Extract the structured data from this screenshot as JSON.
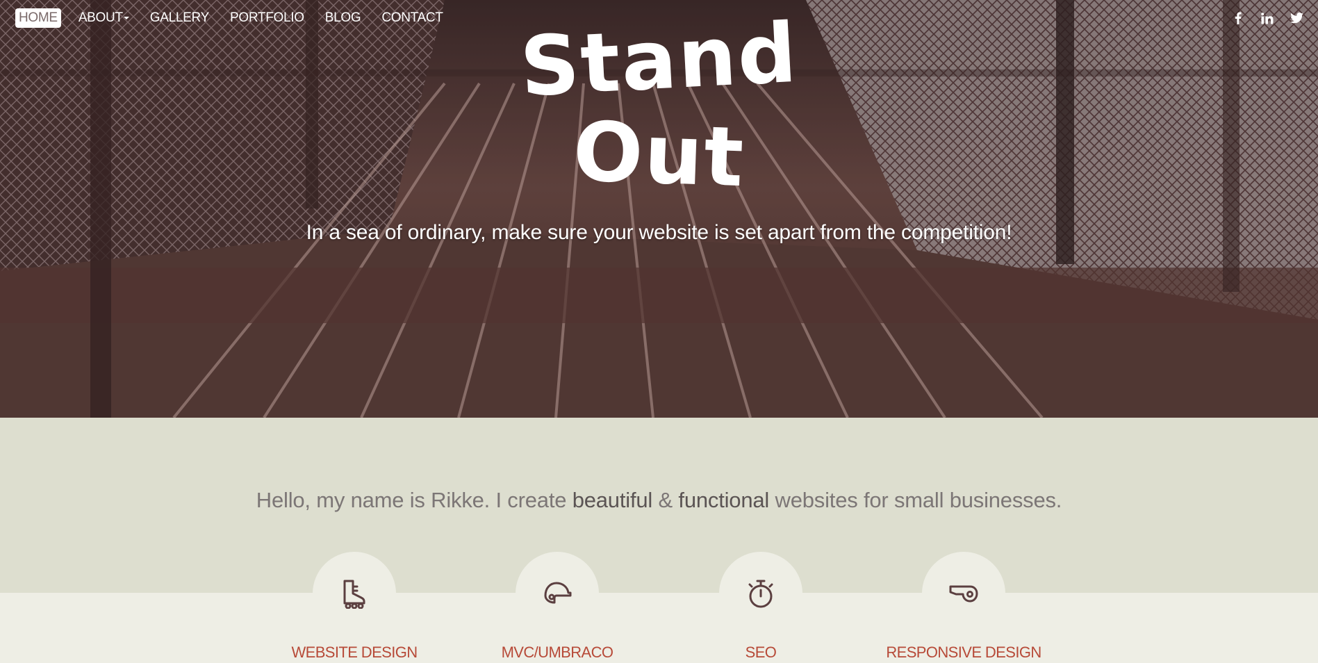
{
  "nav": {
    "items": [
      {
        "label": "HOME",
        "active": true
      },
      {
        "label": "ABOUT",
        "dropdown": true
      },
      {
        "label": "GALLERY"
      },
      {
        "label": "PORTFOLIO"
      },
      {
        "label": "BLOG"
      },
      {
        "label": "CONTACT"
      }
    ],
    "social": [
      "facebook-icon",
      "linkedin-icon",
      "twitter-icon"
    ]
  },
  "hero": {
    "title_line1": "Stand",
    "title_line2": "Out",
    "tagline": "In a sea of ordinary, make sure your website is set apart from the competition!"
  },
  "intro": {
    "part1": "Hello, my name is Rikke. I create ",
    "em1": "beautiful",
    "part2": " & ",
    "em2": "functional",
    "part3": " websites for small businesses."
  },
  "services": [
    {
      "title": "WEBSITE DESIGN",
      "icon": "roller-skate-icon"
    },
    {
      "title": "MVC/UMBRACO",
      "icon": "helmet-icon"
    },
    {
      "title": "SEO",
      "icon": "stopwatch-icon"
    },
    {
      "title": "RESPONSIVE DESIGN",
      "icon": "whistle-icon"
    }
  ],
  "colors": {
    "hero_bg": "#4a3332",
    "intro_bg": "#dddecf",
    "services_bg": "#eeeee5",
    "service_title": "#b74a38",
    "icon_stroke": "#5b3f40"
  }
}
